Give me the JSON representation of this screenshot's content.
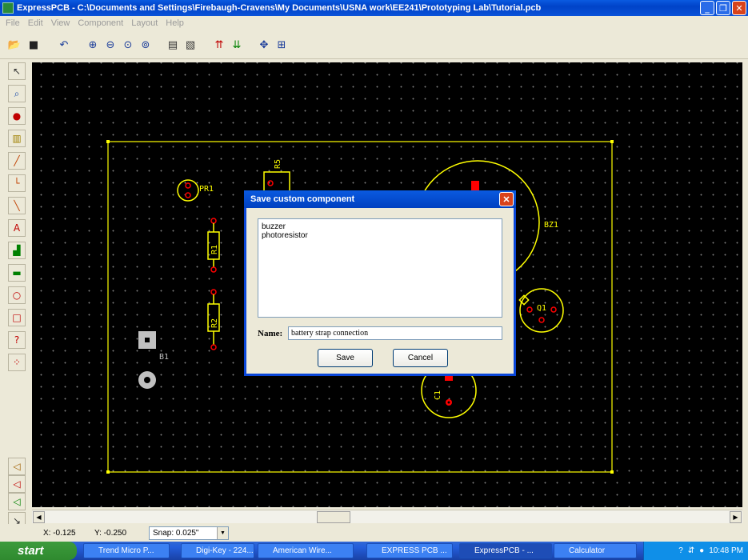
{
  "window": {
    "title": "ExpressPCB - C:\\Documents and Settings\\Firebaugh-Cravens\\My Documents\\USNA work\\EE241\\Prototyping Lab\\Tutorial.pcb"
  },
  "menu": [
    "File",
    "Edit",
    "View",
    "Component",
    "Layout",
    "Help"
  ],
  "toolbar": [
    "open-icon",
    "save-icon",
    "undo-icon",
    "zoom-in-icon",
    "zoom-out-icon",
    "zoom-area-icon",
    "zoom-fit-icon",
    "properties-icon",
    "component-icon",
    "top-layer-icon",
    "bottom-layer-icon",
    "move-icon",
    "center-icon"
  ],
  "canvas": {
    "labels": {
      "pr1": "PR1",
      "r1": "R1",
      "r2": "R2",
      "r5": "R5",
      "bz1": "BZ1",
      "q1": "Q1",
      "b1": "B1",
      "c1": "C1"
    },
    "colors": {
      "outline": "#ffff00",
      "pad": "#ff0000",
      "background": "#000000"
    }
  },
  "dialog": {
    "title": "Save custom component",
    "items": [
      "buzzer",
      "photoresistor"
    ],
    "name_label": "Name:",
    "name_value": "battery strap connection",
    "save_label": "Save",
    "cancel_label": "Cancel"
  },
  "status": {
    "x": "X: -0.125",
    "y": "Y: -0.250",
    "snap": "Snap: 0.025\""
  },
  "taskbar": {
    "start": "start",
    "tasks": [
      "Trend Micro P...",
      "Digi-Key - 224...",
      "American Wire...",
      "EXPRESS PCB ...",
      "ExpressPCB - ...",
      "Calculator"
    ],
    "clock": "10:48 PM"
  }
}
